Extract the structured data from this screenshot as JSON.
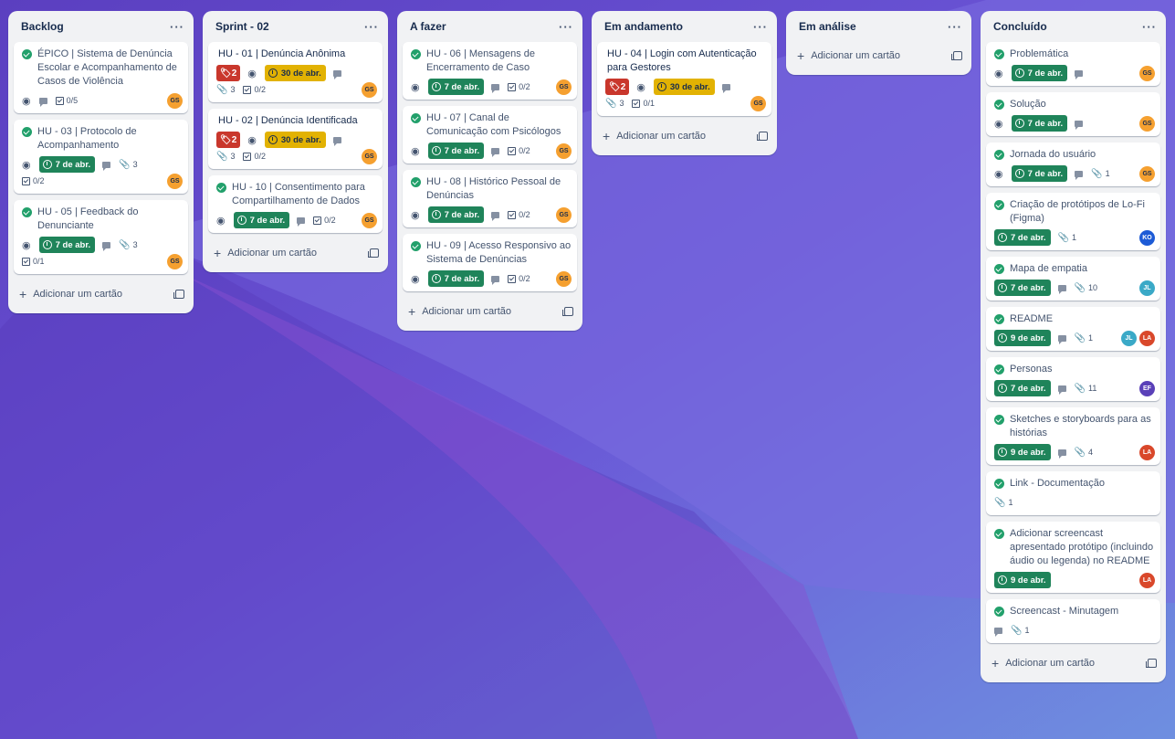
{
  "colors": {
    "background": "#5a4fcf",
    "list": "#f1f2f4",
    "date_green": "#1f845a",
    "date_yellow": "#e2b203",
    "votes_red": "#c9372c",
    "check_green": "#22a06b"
  },
  "add_card_label": "Adicionar um cartão",
  "lists": [
    {
      "title": "Backlog",
      "cards": [
        {
          "title": "ÉPICO | Sistema de Denúncia Escolar e Acompanhamento de Casos de Violência",
          "done": true,
          "watch": true,
          "comment": true,
          "checklist": "0/5",
          "avatars": [
            "GS"
          ]
        },
        {
          "title": "HU - 03 | Protocolo de Acompanhamento",
          "done": true,
          "watch": true,
          "date": "7 de abr.",
          "comment": true,
          "attachments": "3",
          "checklist": "0/2",
          "avatars": [
            "GS"
          ]
        },
        {
          "title": "HU - 05 | Feedback do Denunciante",
          "done": true,
          "watch": true,
          "date": "7 de abr.",
          "comment": true,
          "attachments": "3",
          "checklist": "0/1",
          "avatars": [
            "GS"
          ]
        }
      ]
    },
    {
      "title": "Sprint - 02",
      "cards": [
        {
          "title": "HU - 01 | Denúncia Anônima",
          "done": false,
          "votes": "2",
          "watch": true,
          "date": "30 de abr.",
          "date_color": "yellow",
          "comment": true,
          "attachments": "3",
          "checklist": "0/2",
          "avatars": [
            "GS"
          ]
        },
        {
          "title": "HU - 02 | Denúncia Identificada",
          "done": false,
          "votes": "2",
          "watch": true,
          "date": "30 de abr.",
          "date_color": "yellow",
          "comment": true,
          "attachments": "3",
          "checklist": "0/2",
          "avatars": [
            "GS"
          ]
        },
        {
          "title": "HU - 10 | Consentimento para Compartilhamento de Dados",
          "done": true,
          "watch": true,
          "date": "7 de abr.",
          "comment": true,
          "checklist": "0/2",
          "avatars": [
            "GS"
          ]
        }
      ]
    },
    {
      "title": "A fazer",
      "cards": [
        {
          "title": "HU - 06 | Mensagens de Encerramento de Caso",
          "done": true,
          "watch": true,
          "date": "7 de abr.",
          "comment": true,
          "checklist": "0/2",
          "avatars": [
            "GS"
          ]
        },
        {
          "title": "HU - 07 | Canal de Comunicação com Psicólogos",
          "done": true,
          "watch": true,
          "date": "7 de abr.",
          "comment": true,
          "checklist": "0/2",
          "avatars": [
            "GS"
          ]
        },
        {
          "title": "HU - 08 | Histórico Pessoal de Denúncias",
          "done": true,
          "watch": true,
          "date": "7 de abr.",
          "comment": true,
          "checklist": "0/2",
          "avatars": [
            "GS"
          ]
        },
        {
          "title": "HU - 09 | Acesso Responsivo ao Sistema de Denúncias",
          "done": true,
          "watch": true,
          "date": "7 de abr.",
          "comment": true,
          "checklist": "0/2",
          "avatars": [
            "GS"
          ]
        }
      ]
    },
    {
      "title": "Em andamento",
      "cards": [
        {
          "title": "HU - 04 | Login com Autenticação para Gestores",
          "done": false,
          "votes": "2",
          "watch": true,
          "date": "30 de abr.",
          "date_color": "yellow",
          "comment": true,
          "attachments": "3",
          "checklist": "0/1",
          "avatars": [
            "GS"
          ]
        }
      ]
    },
    {
      "title": "Em análise",
      "cards": []
    },
    {
      "title": "Concluído",
      "cards": [
        {
          "title": "Problemática",
          "done": true,
          "watch": true,
          "date": "7 de abr.",
          "comment": true,
          "avatars": [
            "GS"
          ]
        },
        {
          "title": "Solução",
          "done": true,
          "watch": true,
          "date": "7 de abr.",
          "comment": true,
          "avatars": [
            "GS"
          ]
        },
        {
          "title": "Jornada do usuário",
          "done": true,
          "watch": true,
          "date": "7 de abr.",
          "comment": true,
          "attachments": "1",
          "avatars": [
            "GS"
          ]
        },
        {
          "title": "Criação de protótipos de Lo-Fi (Figma)",
          "done": true,
          "date": "7 de abr.",
          "attachments": "1",
          "avatars": [
            "KO"
          ]
        },
        {
          "title": "Mapa de empatia",
          "done": true,
          "date": "7 de abr.",
          "comment": true,
          "attachments": "10",
          "avatars": [
            "JL"
          ]
        },
        {
          "title": "README",
          "done": true,
          "date": "9 de abr.",
          "comment": true,
          "attachments": "1",
          "avatars": [
            "JL",
            "LA"
          ]
        },
        {
          "title": "Personas",
          "done": true,
          "date": "7 de abr.",
          "comment": true,
          "attachments": "11",
          "avatars": [
            "EF"
          ]
        },
        {
          "title": "Sketches e storyboards para as histórias",
          "done": true,
          "date": "9 de abr.",
          "comment": true,
          "attachments": "4",
          "avatars": [
            "LA"
          ]
        },
        {
          "title": "Link - Documentação",
          "done": true,
          "attachments": "1",
          "avatars": []
        },
        {
          "title": "Adicionar screencast apresentado protótipo (incluindo áudio ou legenda) no README",
          "done": true,
          "date": "9 de abr.",
          "avatars": [
            "LA"
          ]
        },
        {
          "title": "Screencast - Minutagem",
          "done": true,
          "comment": true,
          "attachments": "1",
          "avatars": []
        }
      ]
    }
  ]
}
